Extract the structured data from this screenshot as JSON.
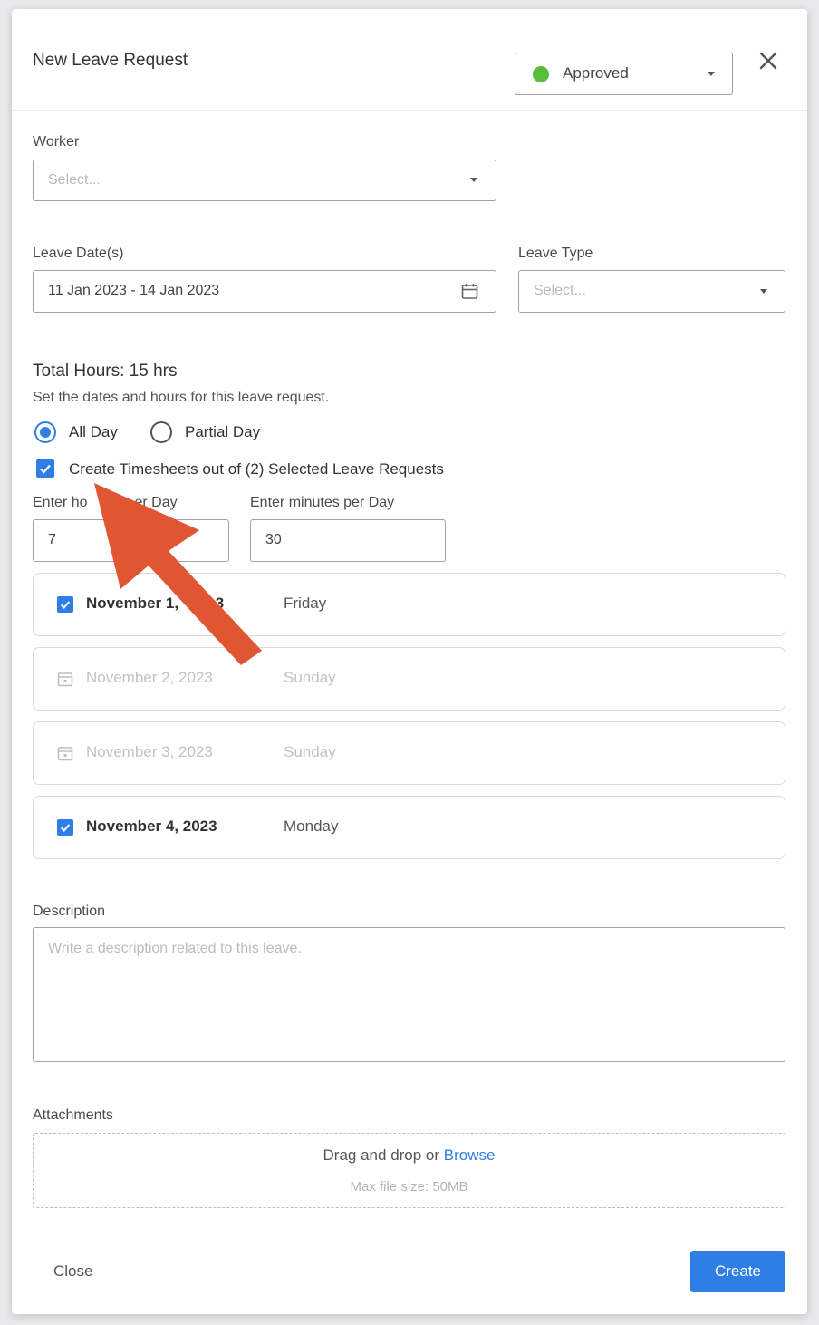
{
  "header": {
    "title": "New Leave Request",
    "status": {
      "label": "Approved",
      "color": "#55bf3b"
    }
  },
  "worker": {
    "label": "Worker",
    "placeholder": "Select..."
  },
  "leave_dates": {
    "label": "Leave Date(s)",
    "value": "11 Jan 2023 - 14 Jan 2023"
  },
  "leave_type": {
    "label": "Leave Type",
    "placeholder": "Select..."
  },
  "hours": {
    "total": "Total Hours: 15 hrs",
    "subtitle": "Set the dates and hours for this leave request.",
    "all_day": "All Day",
    "partial_day": "Partial Day",
    "create_timesheets": "Create Timesheets out of (2) Selected Leave Requests",
    "hours_label_left": "Enter ho",
    "hours_label_right": "er Day",
    "hours_value": "7",
    "minutes_label": "Enter minutes per Day",
    "minutes_value": "30"
  },
  "days": [
    {
      "date": "November 1, ",
      "date_tail": "3",
      "dow": "Friday",
      "checked": true
    },
    {
      "date": "November 2, 2023",
      "dow": "Sunday",
      "checked": false
    },
    {
      "date": "November 3, 2023",
      "dow": "Sunday",
      "checked": false
    },
    {
      "date": "November 4, 2023",
      "dow": "Monday",
      "checked": true
    }
  ],
  "description": {
    "label": "Description",
    "placeholder": "Write a description related to this leave."
  },
  "attachments": {
    "label": "Attachments",
    "drop_text": "Drag and drop or ",
    "browse": "Browse",
    "max_size": "Max file size: 50MB"
  },
  "footer": {
    "close": "Close",
    "create": "Create"
  },
  "annotation": {
    "arrow_color": "#e05532"
  }
}
